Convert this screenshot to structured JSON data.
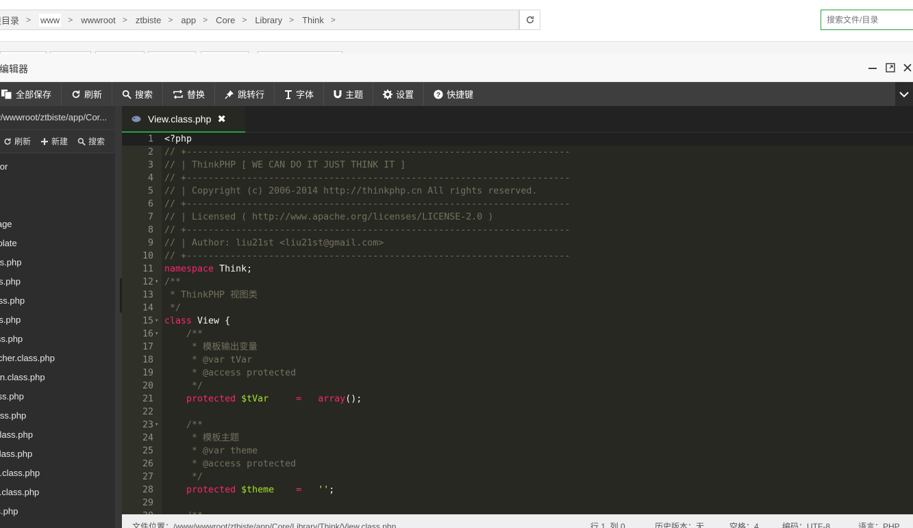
{
  "breadcrumb": {
    "items": [
      {
        "label": "根目录"
      },
      {
        "label": "www"
      },
      {
        "label": "wwwroot"
      },
      {
        "label": "ztbiste"
      },
      {
        "label": "app"
      },
      {
        "label": "Core"
      },
      {
        "label": "Library"
      },
      {
        "label": "Think"
      }
    ],
    "search_placeholder": "搜索文件/目录"
  },
  "editor": {
    "title": "在线编辑器",
    "toolbar": {
      "save_all": "全部保存",
      "refresh": "刷新",
      "search": "搜索",
      "replace": "替换",
      "goto_line": "跳转行",
      "font": "字体",
      "theme": "主题",
      "settings": "设置",
      "shortcuts": "快捷键"
    },
    "sidebar": {
      "path": "/www/wwwroot/ztbiste/app/Cor...",
      "actions": {
        "refresh": "刷新",
        "new": "新建",
        "search": "搜索"
      },
      "files": [
        "Behavior",
        "",
        "",
        "Storage",
        "Template",
        "Build.class.php",
        "Model.class.php",
        "Cache.class.php",
        "Controller.class.php",
        "Db.class.php",
        "Dispatcher.class.php",
        "Exception.class.php",
        "Hook.class.php",
        "Log.class.php",
        "Model.class.php",
        "Route.class.php",
        "Storage.class.php",
        "Template.class.php",
        "Think.class.php"
      ]
    },
    "tab": {
      "label": "View.class.php"
    },
    "code_lines": [
      {
        "n": "1",
        "fold": "",
        "parts": [
          [
            "plain",
            "<?php"
          ]
        ],
        "current": true
      },
      {
        "n": "2",
        "fold": "",
        "parts": [
          [
            "comment",
            "// +----------------------------------------------------------------------"
          ]
        ]
      },
      {
        "n": "3",
        "fold": "",
        "parts": [
          [
            "comment",
            "// | ThinkPHP [ WE CAN DO IT JUST THINK IT ]"
          ]
        ]
      },
      {
        "n": "4",
        "fold": "",
        "parts": [
          [
            "comment",
            "// +----------------------------------------------------------------------"
          ]
        ]
      },
      {
        "n": "5",
        "fold": "",
        "parts": [
          [
            "comment",
            "// | Copyright (c) 2006-2014 http://thinkphp.cn All rights reserved."
          ]
        ]
      },
      {
        "n": "6",
        "fold": "",
        "parts": [
          [
            "comment",
            "// +----------------------------------------------------------------------"
          ]
        ]
      },
      {
        "n": "7",
        "fold": "",
        "parts": [
          [
            "comment",
            "// | Licensed ( http://www.apache.org/licenses/LICENSE-2.0 )"
          ]
        ]
      },
      {
        "n": "8",
        "fold": "",
        "parts": [
          [
            "comment",
            "// +----------------------------------------------------------------------"
          ]
        ]
      },
      {
        "n": "9",
        "fold": "",
        "parts": [
          [
            "comment",
            "// | Author: liu21st <liu21st@gmail.com>"
          ]
        ]
      },
      {
        "n": "10",
        "fold": "",
        "parts": [
          [
            "comment",
            "// +----------------------------------------------------------------------"
          ]
        ]
      },
      {
        "n": "11",
        "fold": "",
        "parts": [
          [
            "kw",
            "namespace"
          ],
          [
            "plain",
            " Think;"
          ]
        ]
      },
      {
        "n": "12",
        "fold": "▾",
        "parts": [
          [
            "comment",
            "/**"
          ]
        ]
      },
      {
        "n": "13",
        "fold": "",
        "parts": [
          [
            "comment",
            " * ThinkPHP 视图类"
          ]
        ]
      },
      {
        "n": "14",
        "fold": "",
        "parts": [
          [
            "comment",
            " */"
          ]
        ]
      },
      {
        "n": "15",
        "fold": "▾",
        "parts": [
          [
            "kw",
            "class"
          ],
          [
            "plain",
            " View {"
          ]
        ]
      },
      {
        "n": "16",
        "fold": "▾",
        "parts": [
          [
            "comment",
            "    /**"
          ]
        ]
      },
      {
        "n": "17",
        "fold": "",
        "parts": [
          [
            "comment",
            "     * 模板输出变量"
          ]
        ]
      },
      {
        "n": "18",
        "fold": "",
        "parts": [
          [
            "comment",
            "     * @var tVar"
          ]
        ]
      },
      {
        "n": "19",
        "fold": "",
        "parts": [
          [
            "comment",
            "     * @access protected"
          ]
        ]
      },
      {
        "n": "20",
        "fold": "",
        "parts": [
          [
            "comment",
            "     */"
          ]
        ]
      },
      {
        "n": "21",
        "fold": "",
        "parts": [
          [
            "plain",
            "    "
          ],
          [
            "kw",
            "protected"
          ],
          [
            "plain",
            " "
          ],
          [
            "var",
            "$tVar"
          ],
          [
            "plain",
            "     "
          ],
          [
            "kw",
            "="
          ],
          [
            "plain",
            "   "
          ],
          [
            "kw",
            "array"
          ],
          [
            "plain",
            "();"
          ]
        ]
      },
      {
        "n": "22",
        "fold": "",
        "parts": [
          [
            "plain",
            ""
          ]
        ]
      },
      {
        "n": "23",
        "fold": "▾",
        "parts": [
          [
            "comment",
            "    /**"
          ]
        ]
      },
      {
        "n": "24",
        "fold": "",
        "parts": [
          [
            "comment",
            "     * 模板主题"
          ]
        ]
      },
      {
        "n": "25",
        "fold": "",
        "parts": [
          [
            "comment",
            "     * @var theme"
          ]
        ]
      },
      {
        "n": "26",
        "fold": "",
        "parts": [
          [
            "comment",
            "     * @access protected"
          ]
        ]
      },
      {
        "n": "27",
        "fold": "",
        "parts": [
          [
            "comment",
            "     */"
          ]
        ]
      },
      {
        "n": "28",
        "fold": "",
        "parts": [
          [
            "plain",
            "    "
          ],
          [
            "kw",
            "protected"
          ],
          [
            "plain",
            " "
          ],
          [
            "var",
            "$theme"
          ],
          [
            "plain",
            "    "
          ],
          [
            "kw",
            "="
          ],
          [
            "plain",
            "   "
          ],
          [
            "str",
            "''"
          ],
          [
            "plain",
            ";"
          ]
        ]
      },
      {
        "n": "29",
        "fold": "",
        "parts": [
          [
            "plain",
            ""
          ]
        ]
      },
      {
        "n": "30",
        "fold": "",
        "parts": [
          [
            "comment",
            "    /**"
          ]
        ]
      }
    ],
    "status": {
      "file_path": "文件位置：/www/wwwroot/ztbiste/app/Core/Library/Think/View.class.php",
      "cursor": "行 1, 列 0",
      "history": "历史版本：无",
      "indent": "空格：4",
      "encoding": "编码：UTF-8",
      "language": "语言：PHP"
    }
  },
  "colors": {
    "accent": "#20a53a",
    "editor_bg": "#272822",
    "toolbar_bg": "#3e3e3e",
    "keyword": "#f92672",
    "variable": "#a6e22e",
    "string": "#e6db74",
    "comment": "#75715e"
  }
}
